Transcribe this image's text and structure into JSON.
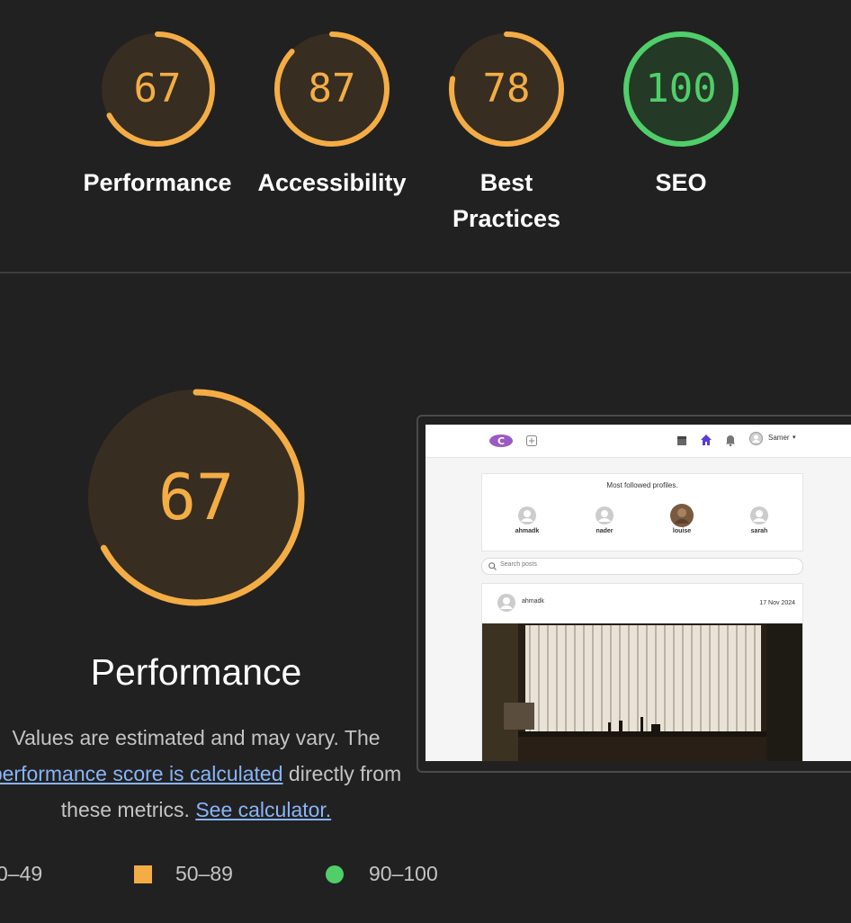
{
  "colors": {
    "background": "#212121",
    "average": "#f4ad44",
    "average_fill": "#372d21",
    "pass": "#4fce6a",
    "pass_fill": "#253a26",
    "fail": "#ff4e42",
    "link": "#8ab4f8"
  },
  "scores": [
    {
      "label": "Performance",
      "value": 67,
      "status": "average"
    },
    {
      "label": "Accessibility",
      "value": 87,
      "status": "average"
    },
    {
      "label": "Best Practices",
      "value": 78,
      "status": "average"
    },
    {
      "label": "SEO",
      "value": 100,
      "status": "pass"
    }
  ],
  "performance": {
    "value": 67,
    "title": "Performance",
    "desc_text1": "Values are estimated and may vary. The ",
    "desc_link1": "performance score is calculated",
    "desc_text2": " directly from these metrics. ",
    "desc_link2": "See calculator."
  },
  "legend": [
    {
      "range": "0–49",
      "shape": "triangle",
      "status": "fail"
    },
    {
      "range": "50–89",
      "shape": "square",
      "status": "average"
    },
    {
      "range": "90–100",
      "shape": "circle",
      "status": "pass"
    }
  ],
  "screenshot": {
    "user_name": "Samer",
    "section_title": "Most followed profiles.",
    "profiles": [
      "ahmadk",
      "nader",
      "louise",
      "sarah"
    ],
    "search_placeholder": "Search posts",
    "post_author": "ahmadk",
    "post_date": "17 Nov 2024"
  }
}
